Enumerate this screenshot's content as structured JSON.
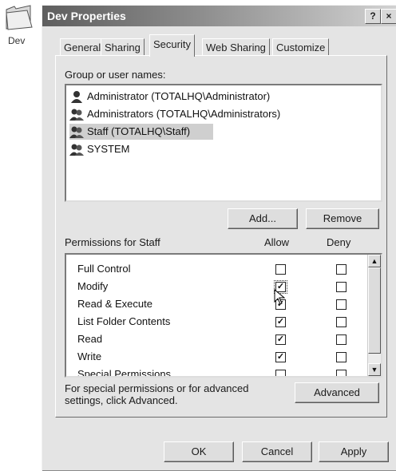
{
  "desktop": {
    "folder_label": "Dev",
    "folder_icon": "folder-icon"
  },
  "window": {
    "title": "Dev Properties",
    "help_label": "?",
    "close_label": "×"
  },
  "tabs": [
    {
      "label": "General"
    },
    {
      "label": "Sharing"
    },
    {
      "label": "Security",
      "active": true
    },
    {
      "label": "Web Sharing"
    },
    {
      "label": "Customize"
    }
  ],
  "security": {
    "group_label": "Group or user names:",
    "users": [
      {
        "name": "Administrator (TOTALHQ\\Administrator)",
        "icon": "user-icon",
        "selected": false
      },
      {
        "name": "Administrators (TOTALHQ\\Administrators)",
        "icon": "group-icon",
        "selected": false
      },
      {
        "name": "Staff (TOTALHQ\\Staff)",
        "icon": "group-icon",
        "selected": true
      },
      {
        "name": "SYSTEM",
        "icon": "group-icon",
        "selected": false
      }
    ],
    "add_button": "Add...",
    "remove_button": "Remove",
    "permissions_label": "Permissions for Staff",
    "allow_header": "Allow",
    "deny_header": "Deny",
    "permissions": [
      {
        "name": "Full Control",
        "allow": false,
        "deny": false
      },
      {
        "name": "Modify",
        "allow": true,
        "deny": false
      },
      {
        "name": "Read & Execute",
        "allow": true,
        "deny": false
      },
      {
        "name": "List Folder Contents",
        "allow": true,
        "deny": false
      },
      {
        "name": "Read",
        "allow": true,
        "deny": false
      },
      {
        "name": "Write",
        "allow": true,
        "deny": false
      },
      {
        "name": "Special Permissions",
        "allow": false,
        "deny": false
      }
    ],
    "advanced_text": "For special permissions or for advanced settings, click Advanced.",
    "advanced_button": "Advanced"
  },
  "footer": {
    "ok_button": "OK",
    "cancel_button": "Cancel",
    "apply_button": "Apply"
  }
}
